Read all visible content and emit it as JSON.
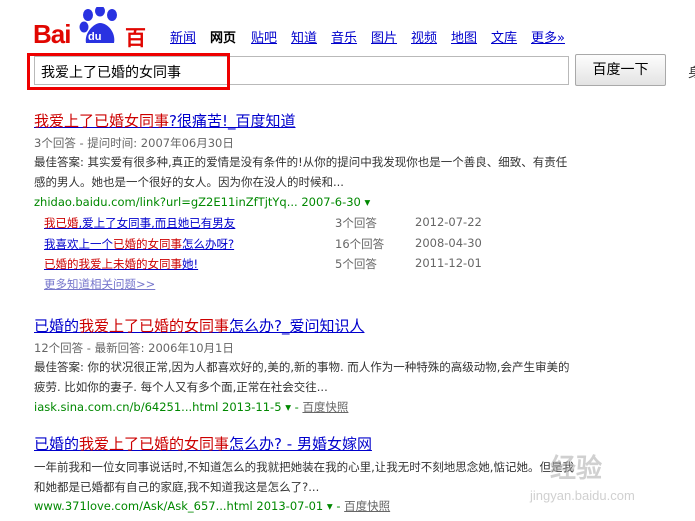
{
  "logo": {
    "bai": "Bai",
    "du": "du",
    "cn": "百度"
  },
  "nav": [
    {
      "label": "新闻",
      "current": false
    },
    {
      "label": "网页",
      "current": true
    },
    {
      "label": "贴吧",
      "current": false
    },
    {
      "label": "知道",
      "current": false
    },
    {
      "label": "音乐",
      "current": false
    },
    {
      "label": "图片",
      "current": false
    },
    {
      "label": "视频",
      "current": false
    },
    {
      "label": "地图",
      "current": false
    },
    {
      "label": "文库",
      "current": false
    },
    {
      "label": "更多»",
      "current": false
    }
  ],
  "search": {
    "value": "我爱上了已婚的女同事",
    "button": "百度一下",
    "edge_glyph": "身"
  },
  "results": [
    {
      "title_pre": "",
      "title_em": "我爱上了已婚女同事",
      "title_post": "?很痛苦!_百度知道",
      "meta": "3个回答 - 提问时间: 2007年06月30日",
      "snippet": "最佳答案: 其实爱有很多种,真正的爱情是没有条件的!从你的提问中我发现你也是一个善良、细致、有责任感的男人。她也是一个很好的女人。因为你在没人的时候和...",
      "url": "zhidao.baidu.com/link?url=gZ2E11inZfTjtYq... 2007-6-30",
      "sub": [
        {
          "pre": "",
          "em": "我已婚",
          "post": ",爱上了女同事,而且她已有男友",
          "count": "3个回答",
          "date": "2012-07-22"
        },
        {
          "pre": "我喜欢上一个",
          "em": "已婚的女同事",
          "post": "怎么办呀?",
          "count": "16个回答",
          "date": "2008-04-30"
        },
        {
          "pre": "",
          "em": "已婚的我爱上未婚的女同事",
          "post": "她!",
          "count": "5个回答",
          "date": "2011-12-01"
        }
      ],
      "more": "更多知道相关问题>>"
    },
    {
      "title_pre": "已婚的",
      "title_em": "我爱上了已婚的女同事",
      "title_post": "怎么办?_爱问知识人",
      "meta": "12个回答 - 最新回答: 2006年10月1日",
      "snippet": "最佳答案: 你的状况很正常,因为人都喜欢好的,美的,新的事物. 而人作为一种特殊的高级动物,会产生审美的疲劳. 比如你的妻子. 每个人又有多个面,正常在社会交往...",
      "url": "iask.sina.com.cn/b/64251...html 2013-11-5",
      "snapshot": "百度快照"
    },
    {
      "title_pre": "已婚的",
      "title_em": "我爱上了已婚的女同事",
      "title_post": "怎么办? - 男婚女嫁网",
      "snippet": "一年前我和一位女同事说话时,不知道怎么的我就把她装在我的心里,让我无时不刻地思念她,惦记她。但是我和她都是已婚都有自己的家庭,我不知道我这是怎么了?...",
      "url": "www.371love.com/Ask/Ask_657...html 2013-07-01",
      "snapshot": "百度快照"
    }
  ],
  "watermark": {
    "line1": "经验",
    "line2": "jingyan.baidu.com"
  },
  "colors": {
    "brand_red": "#e10601",
    "link": "#0000cc",
    "url_green": "#008000",
    "highlight": "#ee0000"
  }
}
